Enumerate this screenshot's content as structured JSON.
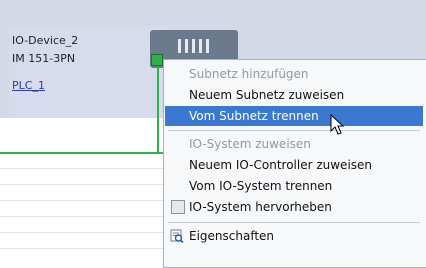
{
  "device": {
    "name": "IO-Device_2",
    "type": "IM 151-3PN",
    "controller_link": "PLC_1"
  },
  "colors": {
    "subnet": "#2fb24a",
    "selection": "#3b78d1",
    "canvas": "#d4d9e8"
  },
  "context_menu": {
    "items": [
      {
        "label": "Subnetz hinzufügen",
        "enabled": false
      },
      {
        "label": "Neuem Subnetz zuweisen",
        "enabled": true
      },
      {
        "label": "Vom Subnetz trennen",
        "enabled": true,
        "selected": true
      },
      {
        "label": "IO-System zuweisen",
        "enabled": false
      },
      {
        "label": "Neuem IO-Controller zuweisen",
        "enabled": true
      },
      {
        "label": "Vom IO-System trennen",
        "enabled": true
      },
      {
        "label": "IO-System hervorheben",
        "enabled": true,
        "icon": "checkbox-icon"
      },
      {
        "label": "Eigenschaften",
        "enabled": true,
        "icon": "properties-icon"
      }
    ]
  }
}
